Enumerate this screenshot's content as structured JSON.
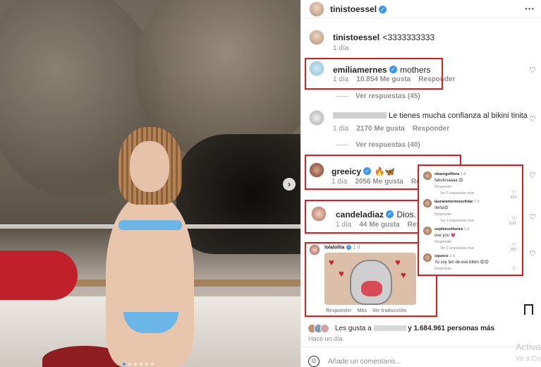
{
  "post_author": "tinistoessel",
  "caption": {
    "username": "tinistoessel",
    "text": "<3333333333",
    "time": "1 día"
  },
  "comments": [
    {
      "username": "emiliamernes",
      "text": "mothers",
      "time": "1 día",
      "likes": "10.854 Me gusta",
      "reply": "Responder",
      "view_replies": "Ver respuestas (45)"
    },
    {
      "username": "",
      "text": "Le tienes mucha confianza al bikini tinita",
      "time": "1 día",
      "likes": "2170 Me gusta",
      "reply": "Responder",
      "view_replies": "Ver respuestas (40)"
    },
    {
      "username": "greeicy",
      "text": "🔥🦋",
      "time": "1 día",
      "likes": "2056 Me gusta",
      "reply": "Responder"
    },
    {
      "username": "candeladiaz",
      "text": "Dios.",
      "time": "1 día",
      "likes": "44 Me gusta",
      "reply": "Responder"
    }
  ],
  "gif_comment": {
    "username": "lolalolita",
    "time": "1 d",
    "reply": "Responder",
    "more": "Más",
    "translation": "Ver traducción"
  },
  "popup": [
    {
      "username": "nbarogolfiera",
      "time": "1 d",
      "text": "fabulosaaaa 😍",
      "meta": "Responder",
      "more": "Ver 5 respuestas más",
      "count": "434"
    },
    {
      "username": "lauraramerinescfolar",
      "time": "1 d",
      "text": "Ilerta😍",
      "meta": "Responder",
      "more": "Ver 3 respuestas más",
      "count": "1121"
    },
    {
      "username": "sophiesoliveira",
      "time": "1 d",
      "text": "ove you 💗",
      "meta": "Responder",
      "more": "Ver 2 respuestas más",
      "count": "252"
    },
    {
      "username": "cquoco",
      "time": "1 d",
      "text": "Yo soy fan de ese bikini 😍😍",
      "meta": "Responder",
      "more": "",
      "count": ""
    }
  ],
  "likes_summary": "Les gusta a",
  "likes_count": "y 1.684.961 personas más",
  "post_time": "Hace un día",
  "comment_placeholder": "Añade un comentario...",
  "watermark": {
    "line1": "Activa",
    "line2": "Ve a Co"
  },
  "icons": {
    "more": "more-icon",
    "heart": "heart-icon",
    "bookmark": "bookmark-icon",
    "emoji": "emoji-icon",
    "next": "chevron-right-icon"
  }
}
